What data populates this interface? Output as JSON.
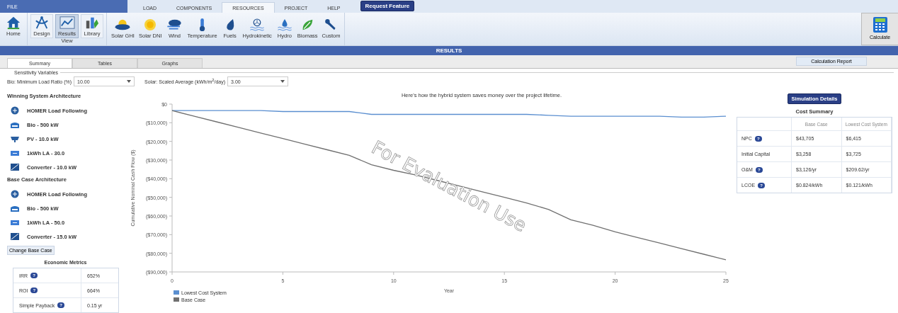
{
  "menu": {
    "file": "FILE",
    "tabs": [
      {
        "label": "LOAD",
        "selected": false
      },
      {
        "label": "COMPONENTS",
        "selected": false
      },
      {
        "label": "RESOURCES",
        "selected": true
      },
      {
        "label": "PROJECT",
        "selected": false
      },
      {
        "label": "HELP",
        "selected": false
      }
    ],
    "request_button": "Request Feature"
  },
  "ribbon": {
    "home": {
      "label": "Home"
    },
    "view_group": {
      "label": "View",
      "buttons": [
        {
          "label": "Design",
          "kind": "design",
          "selected": false
        },
        {
          "label": "Results",
          "kind": "results",
          "selected": true
        },
        {
          "label": "Library",
          "kind": "library",
          "selected": false
        }
      ]
    },
    "resources": [
      {
        "label": "Solar GHI",
        "kind": "solar_ghi"
      },
      {
        "label": "Solar DNI",
        "kind": "solar_dni"
      },
      {
        "label": "Wind",
        "kind": "wind"
      },
      {
        "label": "Temperature",
        "kind": "temperature"
      },
      {
        "label": "Fuels",
        "kind": "fuels"
      },
      {
        "label": "Hydrokinetic",
        "kind": "hydrokinetic"
      },
      {
        "label": "Hydro",
        "kind": "hydro"
      },
      {
        "label": "Biomass",
        "kind": "biomass"
      },
      {
        "label": "Custom",
        "kind": "custom"
      }
    ],
    "calculate_button": "Calculate"
  },
  "results_title": "RESULTS",
  "view_tabs": [
    {
      "label": "Summary",
      "selected": true
    },
    {
      "label": "Tables",
      "selected": false
    },
    {
      "label": "Graphs",
      "selected": false
    }
  ],
  "calculation_report_button": "Calculation Report",
  "sensitivity": {
    "legend": "Sensitivity Variables",
    "fields": [
      {
        "label": "Bio: Minimum Load Ratio (%)",
        "value": "10.00"
      },
      {
        "label": "Solar: Scaled Average (kWh/m$^{2}$/day)",
        "value": "3.00"
      }
    ]
  },
  "winning_architecture": {
    "title": "Winning System Architecture",
    "items": [
      {
        "label": "HOMER Load Following",
        "kind": "dispatch"
      },
      {
        "label": "Bio - 500 kW",
        "kind": "generator"
      },
      {
        "label": "PV - 10.0 kW",
        "kind": "pv"
      },
      {
        "label": "1kWh LA - 30.0",
        "kind": "battery"
      },
      {
        "label": "Converter - 10.0 kW",
        "kind": "converter"
      }
    ]
  },
  "base_case_architecture": {
    "title": "Base Case Architecture",
    "items": [
      {
        "label": "HOMER Load Following",
        "kind": "dispatch"
      },
      {
        "label": "Bio - 500 kW",
        "kind": "generator"
      },
      {
        "label": "1kWh LA - 50.0",
        "kind": "battery"
      },
      {
        "label": "Converter - 15.0 kW",
        "kind": "converter"
      }
    ],
    "change_button": "Change Base Case"
  },
  "economic_metrics": {
    "title": "Economic Metrics",
    "rows": [
      {
        "label": "IRR",
        "help": "?",
        "value": "652%"
      },
      {
        "label": "ROI",
        "help": "?",
        "value": "664%"
      },
      {
        "label": "Simple Payback",
        "help": "?",
        "value": "0.15 yr"
      }
    ]
  },
  "cash_flow": {
    "caption": "Here's how the hybrid system saves money over the project lifetime.",
    "watermark": "For Evaluation Use",
    "chart_data": {
      "type": "line",
      "legend": "bottom",
      "xlabel": "Year",
      "ylabel": "Cumulative Nominal Cash Flow ($)",
      "x": [
        0,
        1,
        2,
        3,
        4,
        5,
        6,
        7,
        8,
        9,
        10,
        11,
        12,
        13,
        14,
        15,
        16,
        17,
        18,
        19,
        20,
        21,
        22,
        23,
        24,
        25
      ],
      "series": [
        {
          "name": "Lowest Cost System",
          "color": "#5b8fd0",
          "values": [
            -3500,
            -3500,
            -3500,
            -3500,
            -3500,
            -4000,
            -4000,
            -4000,
            -4000,
            -5500,
            -5500,
            -5500,
            -5500,
            -5500,
            -5500,
            -5500,
            -5500,
            -6000,
            -6500,
            -6500,
            -6500,
            -6500,
            -6500,
            -7000,
            -7000,
            -6500
          ]
        },
        {
          "name": "Base Case",
          "color": "#707070",
          "values": [
            -3500,
            -6500,
            -9500,
            -12500,
            -15500,
            -18500,
            -21500,
            -24500,
            -27500,
            -32500,
            -35500,
            -38000,
            -41000,
            -44000,
            -47000,
            -50000,
            -53000,
            -56500,
            -62000,
            -65000,
            -68500,
            -71500,
            -74500,
            -77500,
            -80500,
            -83500
          ]
        }
      ],
      "xlim": [
        0,
        25
      ],
      "ylim": [
        -90000,
        0
      ],
      "xticks": [
        0,
        5,
        10,
        15,
        20,
        25
      ],
      "yticks": [
        {
          "value": 0,
          "label": "$0"
        },
        {
          "value": -10000,
          "label": "($10,000)"
        },
        {
          "value": -20000,
          "label": "($20,000)"
        },
        {
          "value": -30000,
          "label": "($30,000)"
        },
        {
          "value": -40000,
          "label": "($40,000)"
        },
        {
          "value": -50000,
          "label": "($50,000)"
        },
        {
          "value": -60000,
          "label": "($60,000)"
        },
        {
          "value": -70000,
          "label": "($70,000)"
        },
        {
          "value": -80000,
          "label": "($80,000)"
        },
        {
          "value": -90000,
          "label": "($90,000)"
        }
      ]
    }
  },
  "simulation_details_button": "Simulation Details",
  "cost_summary": {
    "title": "Cost Summary",
    "columns": [
      "Base Case",
      "Lowest Cost System"
    ],
    "rows": [
      {
        "label": "NPC",
        "help": "?",
        "values": [
          "$43,705",
          "$6,415"
        ]
      },
      {
        "label": "Initial Capital",
        "values": [
          "$3,258",
          "$3,725"
        ]
      },
      {
        "label": "O&M",
        "help": "?",
        "values": [
          "$3,126/yr",
          "$209.62/yr"
        ]
      },
      {
        "label": "LCOE",
        "help": "?",
        "values": [
          "$0.824/kWh",
          "$0.121/kWh"
        ]
      }
    ]
  }
}
